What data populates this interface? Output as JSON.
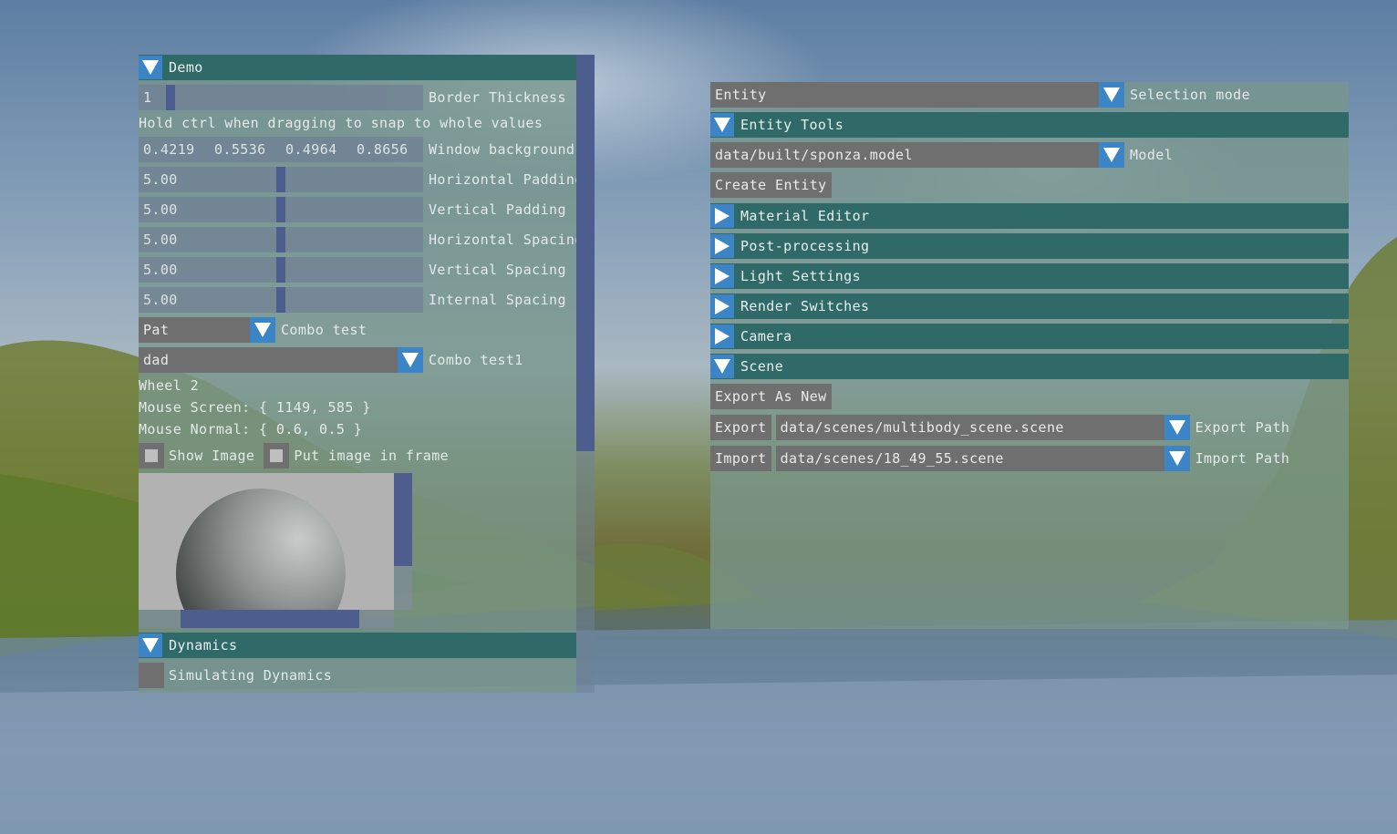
{
  "demo_window": {
    "title": "Demo",
    "border_thickness": {
      "value": "1",
      "label": "Border Thickness"
    },
    "hint": "Hold ctrl when dragging to snap to whole values",
    "window_background": {
      "values": [
        "0.4219",
        "0.5536",
        "0.4964",
        "0.8656"
      ],
      "label": "Window background"
    },
    "sliders": [
      {
        "value": "5.00",
        "label": "Horizontal Padding"
      },
      {
        "value": "5.00",
        "label": "Vertical Padding"
      },
      {
        "value": "5.00",
        "label": "Horizontal Spacing"
      },
      {
        "value": "5.00",
        "label": "Vertical Spacing"
      },
      {
        "value": "5.00",
        "label": "Internal Spacing"
      }
    ],
    "combo_test": {
      "value": "Pat",
      "label": "Combo test"
    },
    "combo_test1": {
      "value": "dad",
      "label": "Combo test1"
    },
    "wheel": "Wheel 2",
    "mouse_screen": "Mouse Screen: { 1149, 585 }",
    "mouse_normal": "Mouse Normal: { 0.6, 0.5 }",
    "show_image": "Show Image",
    "put_image_in_frame": "Put image in frame",
    "dynamics": {
      "title": "Dynamics",
      "simulating": "Simulating Dynamics"
    }
  },
  "entity_window": {
    "selection": {
      "value": "Entity",
      "label": "Selection mode"
    },
    "entity_tools": "Entity Tools",
    "model": {
      "value": "data/built/sponza.model",
      "label": "Model"
    },
    "create_entity": "Create Entity",
    "collapsed_sections": [
      "Material Editor",
      "Post-processing",
      "Light Settings",
      "Render Switches",
      "Camera"
    ],
    "scene": {
      "title": "Scene",
      "export_as_new": "Export As New",
      "export": {
        "button": "Export",
        "path": "data/scenes/multibody_scene.scene",
        "label": "Export Path"
      },
      "import": {
        "button": "Import",
        "path": "data/scenes/18_49_55.scene",
        "label": "Import Path"
      }
    }
  },
  "colors": {
    "header": "#2f6a68",
    "accent": "#3b84c6",
    "slider_grab": "#4d5d8e",
    "panel_bg": "#78968c"
  }
}
